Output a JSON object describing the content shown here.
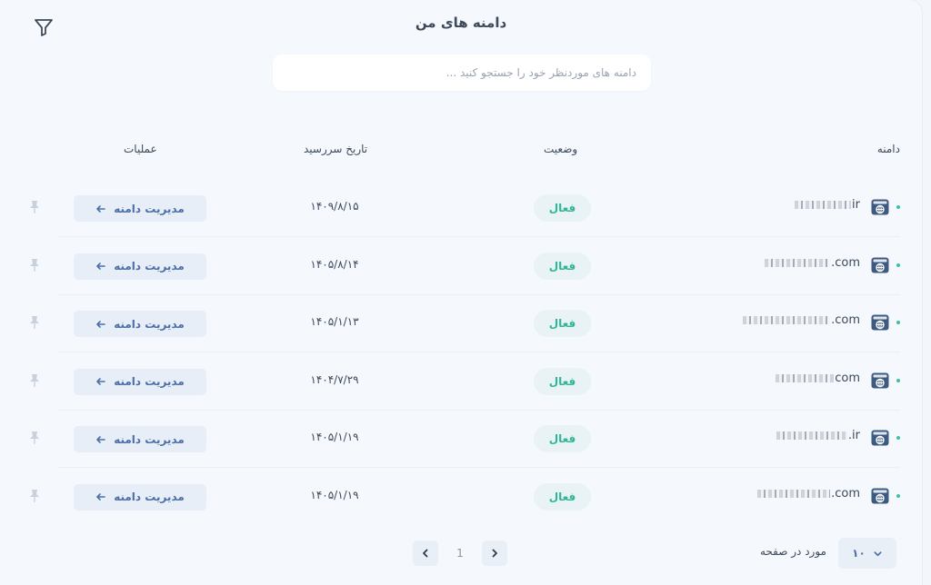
{
  "header": {
    "title": "دامنه های من",
    "search_placeholder": "دامنه های موردنظر خود را جستجو کنید ..."
  },
  "table": {
    "columns": {
      "domain": "دامنه",
      "status": "وضعیت",
      "expiry": "تاریخ سررسید",
      "actions": "عملیات"
    },
    "rows": [
      {
        "domain_suffix": "ir",
        "status": "فعال",
        "expiry": "۱۴۰۹/۸/۱۵",
        "action": "مدیریت دامنه"
      },
      {
        "domain_suffix": ".com",
        "status": "فعال",
        "expiry": "۱۴۰۵/۸/۱۴",
        "action": "مدیریت دامنه"
      },
      {
        "domain_suffix": ".com",
        "status": "فعال",
        "expiry": "۱۴۰۵/۱/۱۳",
        "action": "مدیریت دامنه"
      },
      {
        "domain_suffix": "com",
        "status": "فعال",
        "expiry": "۱۴۰۴/۷/۲۹",
        "action": "مدیریت دامنه"
      },
      {
        "domain_suffix": ".ir",
        "status": "فعال",
        "expiry": "۱۴۰۵/۱/۱۹",
        "action": "مدیریت دامنه"
      },
      {
        "domain_suffix": ".com",
        "status": "فعال",
        "expiry": "۱۴۰۵/۱/۱۹",
        "action": "مدیریت دامنه"
      }
    ]
  },
  "pagination": {
    "current_page": "1",
    "per_page_label": "مورد در صفحه",
    "per_page_value": "۱۰"
  },
  "colors": {
    "accent": "#2fb597",
    "button_text": "#4b6fa8",
    "background": "#f5f8fc"
  }
}
